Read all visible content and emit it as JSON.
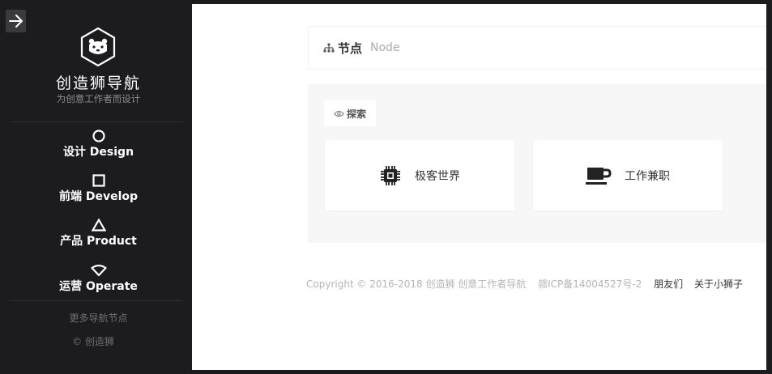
{
  "sidebar": {
    "brand_name": "创造狮导航",
    "brand_sub": "为创意工作者而设计",
    "nav": [
      {
        "label": "设计 Design",
        "icon": "circle-icon"
      },
      {
        "label": "前端 Develop",
        "icon": "square-icon"
      },
      {
        "label": "产品 Product",
        "icon": "triangle-icon"
      },
      {
        "label": "运营 Operate",
        "icon": "wifi-shape-icon"
      }
    ],
    "more": "更多导航节点",
    "copy": "© 创造狮"
  },
  "main": {
    "node_title": "节点",
    "node_sub": "Node",
    "explore_label": "探索",
    "cards": [
      {
        "label": "极客世界",
        "icon": "cpu-chip-icon"
      },
      {
        "label": "工作兼职",
        "icon": "coffee-cup-icon"
      }
    ]
  },
  "footer": {
    "copyright": "Copyright © 2016-2018 创造狮 创意工作者导航",
    "icp": "赣ICP备14004527号-2",
    "links": [
      "朋友们",
      "关于小狮子"
    ]
  }
}
